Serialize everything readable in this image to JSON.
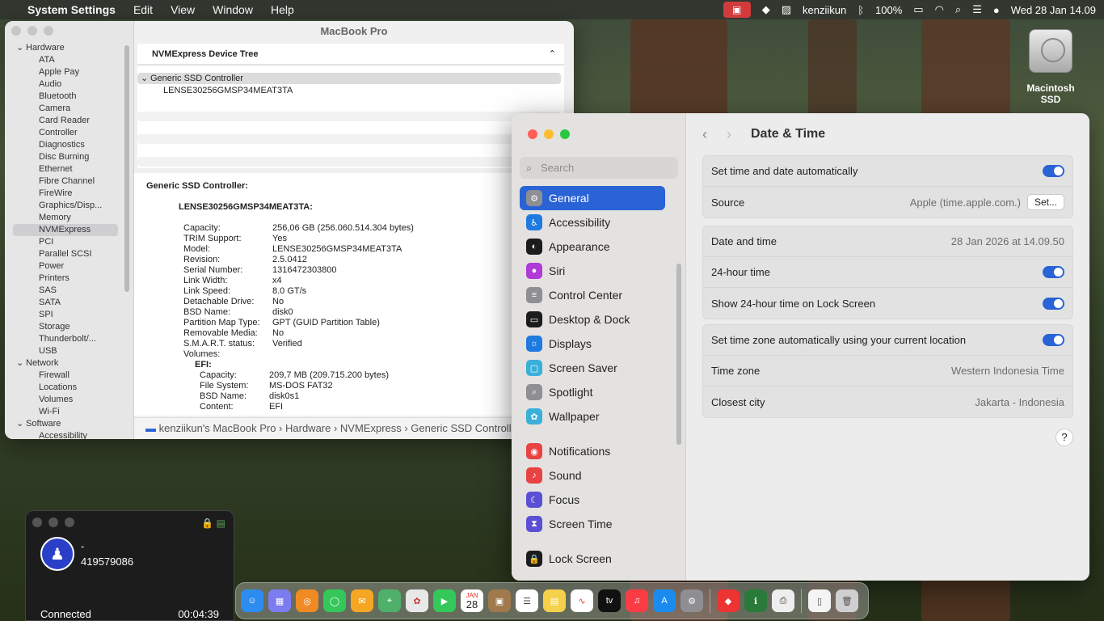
{
  "menubar": {
    "app": "System Settings",
    "items": [
      "Edit",
      "View",
      "Window",
      "Help"
    ],
    "user": "kenziikun",
    "battery": "100%",
    "datetime": "Wed 28 Jan  14.09"
  },
  "sysinfo": {
    "title": "MacBook Pro",
    "sidebar": {
      "hardware": "Hardware",
      "items": [
        "ATA",
        "Apple Pay",
        "Audio",
        "Bluetooth",
        "Camera",
        "Card Reader",
        "Controller",
        "Diagnostics",
        "Disc Burning",
        "Ethernet",
        "Fibre Channel",
        "FireWire",
        "Graphics/Disp...",
        "Memory",
        "NVMExpress",
        "PCI",
        "Parallel SCSI",
        "Power",
        "Printers",
        "SAS",
        "SATA",
        "SPI",
        "Storage",
        "Thunderbolt/...",
        "USB"
      ],
      "network": "Network",
      "network_items": [
        "Firewall",
        "Locations",
        "Volumes",
        "Wi-Fi"
      ],
      "software": "Software",
      "software_items": [
        "Accessibility"
      ]
    },
    "tree_header": "NVMExpress Device Tree",
    "tree_row1": "Generic SSD Controller",
    "tree_row2": "LENSE30256GMSP34MEAT3TA",
    "detail_h1": "Generic SSD Controller:",
    "detail_h2": "LENSE30256GMSP34MEAT3TA:",
    "fields": [
      {
        "k": "Capacity:",
        "v": "256,06 GB (256.060.514.304 bytes)"
      },
      {
        "k": "TRIM Support:",
        "v": "Yes"
      },
      {
        "k": "Model:",
        "v": "LENSE30256GMSP34MEAT3TA"
      },
      {
        "k": "Revision:",
        "v": "2.5.0412"
      },
      {
        "k": "Serial Number:",
        "v": "1316472303800"
      },
      {
        "k": "Link Width:",
        "v": "x4"
      },
      {
        "k": "Link Speed:",
        "v": "8.0 GT/s"
      },
      {
        "k": "Detachable Drive:",
        "v": "No"
      },
      {
        "k": "BSD Name:",
        "v": "disk0"
      },
      {
        "k": "Partition Map Type:",
        "v": "GPT (GUID Partition Table)"
      },
      {
        "k": "Removable Media:",
        "v": "No"
      },
      {
        "k": "S.M.A.R.T. status:",
        "v": "Verified"
      },
      {
        "k": "Volumes:",
        "v": ""
      }
    ],
    "efi_label": "EFI:",
    "efi_fields": [
      {
        "k": "Capacity:",
        "v": "209,7 MB (209.715.200 bytes)"
      },
      {
        "k": "File System:",
        "v": "MS-DOS FAT32"
      },
      {
        "k": "BSD Name:",
        "v": "disk0s1"
      },
      {
        "k": "Content:",
        "v": "EFI"
      }
    ],
    "pathbar": "kenziikun's MacBook Pro  ›  Hardware  ›  NVMExpress  ›  Generic SSD Controller"
  },
  "settings": {
    "search_placeholder": "Search",
    "nav": [
      {
        "label": "General",
        "icon": "gear-icon",
        "color": "#8e8e93",
        "glyph": "⚙"
      },
      {
        "label": "Accessibility",
        "icon": "accessibility-icon",
        "color": "#1f7ae0",
        "glyph": "♿"
      },
      {
        "label": "Appearance",
        "icon": "appearance-icon",
        "color": "#1c1c1e",
        "glyph": "◐"
      },
      {
        "label": "Siri",
        "icon": "siri-icon",
        "color": "#b03bd6",
        "glyph": "●"
      },
      {
        "label": "Control Center",
        "icon": "control-center-icon",
        "color": "#8e8e93",
        "glyph": "≡"
      },
      {
        "label": "Desktop & Dock",
        "icon": "dock-icon",
        "color": "#1c1c1e",
        "glyph": "▭"
      },
      {
        "label": "Displays",
        "icon": "displays-icon",
        "color": "#1f7ae0",
        "glyph": "☼"
      },
      {
        "label": "Screen Saver",
        "icon": "screen-saver-icon",
        "color": "#3ab0d9",
        "glyph": "▢"
      },
      {
        "label": "Spotlight",
        "icon": "spotlight-icon",
        "color": "#8e8e93",
        "glyph": "⌕"
      },
      {
        "label": "Wallpaper",
        "icon": "wallpaper-icon",
        "color": "#3ab0d9",
        "glyph": "✿"
      },
      {
        "label": "Notifications",
        "icon": "notifications-icon",
        "color": "#e84242",
        "glyph": "◉"
      },
      {
        "label": "Sound",
        "icon": "sound-icon",
        "color": "#e84242",
        "glyph": "♪"
      },
      {
        "label": "Focus",
        "icon": "focus-icon",
        "color": "#5b4fd6",
        "glyph": "☾"
      },
      {
        "label": "Screen Time",
        "icon": "screen-time-icon",
        "color": "#5b4fd6",
        "glyph": "⧗"
      },
      {
        "label": "Lock Screen",
        "icon": "lock-icon",
        "color": "#1c1c1e",
        "glyph": "🔒"
      }
    ],
    "page_title": "Date & Time",
    "rows": {
      "auto_time": "Set time and date automatically",
      "source": "Source",
      "source_value": "Apple (time.apple.com.)",
      "set_button": "Set...",
      "date_time": "Date and time",
      "date_time_value": "28 Jan 2026 at 14.09.50",
      "h24": "24-hour time",
      "h24_lock": "Show 24-hour time on Lock Screen",
      "tz_auto": "Set time zone automatically using your current location",
      "tz": "Time zone",
      "tz_value": "Western Indonesia Time",
      "city": "Closest city",
      "city_value": "Jakarta - Indonesia"
    },
    "help": "?"
  },
  "call": {
    "name": "-",
    "number": "419579086",
    "status": "Connected",
    "timer": "00:04:39"
  },
  "desktop": {
    "drive_label": "Macintosh SSD"
  },
  "dock": {
    "calendar_day": "28",
    "calendar_month": "JAN"
  }
}
